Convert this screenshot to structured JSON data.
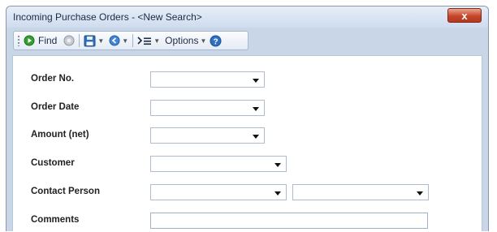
{
  "window": {
    "title": "Incoming Purchase Orders - <New Search>",
    "close_label": "x"
  },
  "toolbar": {
    "find_label": "Find",
    "options_label": "Options",
    "icons": [
      "find-icon",
      "stop-icon",
      "save-icon",
      "back-icon",
      "list-icon",
      "help-icon"
    ]
  },
  "form": {
    "fields": [
      {
        "label": "Order No.",
        "value": ""
      },
      {
        "label": "Order Date",
        "value": ""
      },
      {
        "label": "Amount (net)",
        "value": ""
      },
      {
        "label": "Customer",
        "value": ""
      },
      {
        "label": "Contact Person",
        "value": "",
        "value2": ""
      },
      {
        "label": "Comments",
        "value": ""
      }
    ]
  },
  "colors": {
    "accent": "#2e6fc0",
    "close_button": "#c6452a",
    "find_icon": "#35a031"
  }
}
